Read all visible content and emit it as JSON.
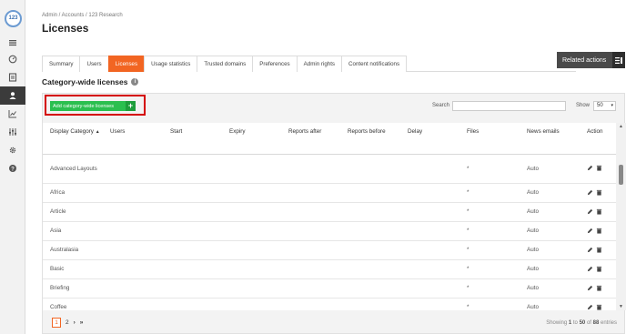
{
  "app": {
    "logo_text": "123",
    "accent": "#f26522",
    "add_color": "#2bbf4f"
  },
  "sidebar": {
    "icons": [
      "menu-icon",
      "dashboard-icon",
      "document-icon",
      "users-icon",
      "chart-icon",
      "sliders-icon",
      "gear-icon",
      "help-icon"
    ],
    "active": "users-icon"
  },
  "breadcrumb": "Admin / Accounts / 123 Research",
  "page_title": "Licenses",
  "tabs": [
    {
      "label": "Summary"
    },
    {
      "label": "Users"
    },
    {
      "label": "Licenses"
    },
    {
      "label": "Usage statistics"
    },
    {
      "label": "Trusted domains"
    },
    {
      "label": "Preferences"
    },
    {
      "label": "Admin rights"
    },
    {
      "label": "Content notifications"
    }
  ],
  "active_tab": "Licenses",
  "related_actions": "Related actions",
  "section_title": "Category-wide licenses",
  "toolbar": {
    "add_label": "Add category-wide licenses",
    "add_plus": "+",
    "search_label": "Search",
    "search_value": "",
    "show_label": "Show",
    "show_value": "50"
  },
  "table": {
    "headers": [
      "Display Category",
      "Users",
      "Start",
      "Expiry",
      "Reports after",
      "Reports before",
      "Delay",
      "Files",
      "News emails",
      "Action"
    ],
    "rows": [
      {
        "category": "Advanced Layouts",
        "files": "*",
        "news": "Auto"
      },
      {
        "category": "Africa",
        "files": "*",
        "news": "Auto"
      },
      {
        "category": "Article",
        "files": "*",
        "news": "Auto"
      },
      {
        "category": "Asia",
        "files": "*",
        "news": "Auto"
      },
      {
        "category": "Australasia",
        "files": "*",
        "news": "Auto"
      },
      {
        "category": "Basic",
        "files": "*",
        "news": "Auto"
      },
      {
        "category": "Briefing",
        "files": "*",
        "news": "Auto"
      },
      {
        "category": "Coffee",
        "files": "*",
        "news": "Auto"
      }
    ]
  },
  "pagination": {
    "pages": [
      "1",
      "2"
    ],
    "current": "1",
    "next": "›",
    "last": "»",
    "summary_prefix": "Showing",
    "from": "1",
    "to_word": "to",
    "to": "50",
    "of_word": "of",
    "total": "88",
    "suffix": "entries"
  }
}
